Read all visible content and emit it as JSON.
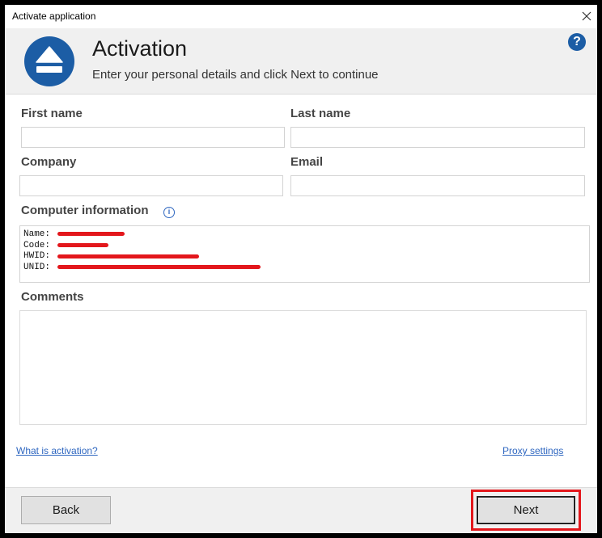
{
  "window": {
    "title": "Activate application",
    "close_icon": "close-icon"
  },
  "header": {
    "title": "Activation",
    "subtitle": "Enter your personal details and click Next to continue",
    "logo_icon": "eject-icon",
    "help_icon": "help-icon",
    "help_glyph": "?"
  },
  "form": {
    "first_name": {
      "label": "First name",
      "value": ""
    },
    "last_name": {
      "label": "Last name",
      "value": ""
    },
    "company": {
      "label": "Company",
      "value": ""
    },
    "email": {
      "label": "Email",
      "value": ""
    },
    "computer_info": {
      "label": "Computer information",
      "info_icon": "info-icon",
      "info_glyph": "i",
      "lines": [
        {
          "key": "Name:",
          "value_redacted": true
        },
        {
          "key": "Code:",
          "value_redacted": true
        },
        {
          "key": "HWID:",
          "value_redacted": true
        },
        {
          "key": "UNID:",
          "value_redacted": true
        }
      ]
    },
    "comments": {
      "label": "Comments",
      "value": ""
    }
  },
  "links": {
    "what_is_activation": "What is activation?",
    "proxy_settings": "Proxy settings"
  },
  "footer": {
    "back_label": "Back",
    "next_label": "Next",
    "next_highlighted": true
  },
  "colors": {
    "accent": "#1c5da5",
    "link": "#2f67c0",
    "highlight": "#e3171c",
    "redaction": "#e3171c",
    "header_bg": "#f0f0f0"
  }
}
